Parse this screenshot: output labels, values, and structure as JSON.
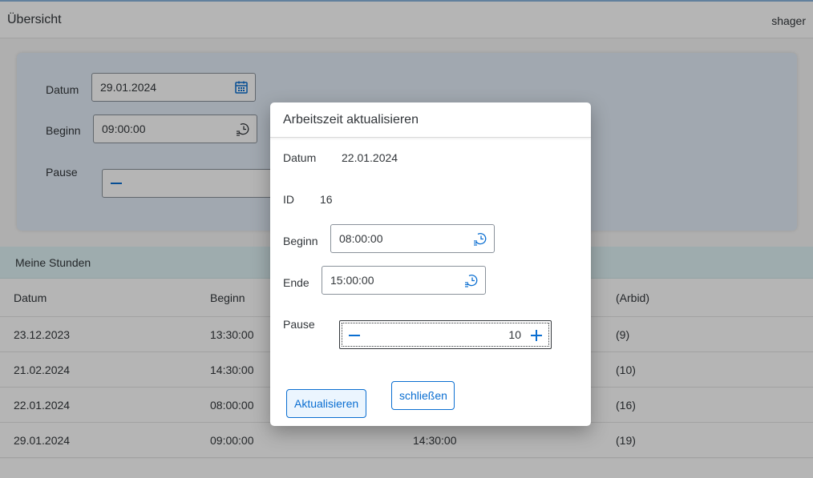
{
  "shell": {
    "title": "Übersicht",
    "user": "shager"
  },
  "form": {
    "date_label": "Datum",
    "date_value": "29.01.2024",
    "start_label": "Beginn",
    "start_value": "09:00:00",
    "pause_label": "Pause"
  },
  "section": {
    "title": "Meine Stunden"
  },
  "table": {
    "headers": [
      "Datum",
      "Beginn",
      "",
      "(Arbid)"
    ],
    "rows": [
      [
        "23.12.2023",
        "13:30:00",
        "",
        "(9)"
      ],
      [
        "21.02.2024",
        "14:30:00",
        "",
        "(10)"
      ],
      [
        "22.01.2024",
        "08:00:00",
        "",
        "(16)"
      ],
      [
        "29.01.2024",
        "09:00:00",
        "14:30:00",
        "(19)"
      ]
    ]
  },
  "dialog": {
    "title": "Arbeitszeit aktualisieren",
    "date_label": "Datum",
    "date_value": "22.01.2024",
    "id_label": "ID",
    "id_value": "16",
    "start_label": "Beginn",
    "start_value": "08:00:00",
    "end_label": "Ende",
    "end_value": "15:00:00",
    "pause_label": "Pause",
    "pause_value": "10",
    "update_button": "Aktualisieren",
    "close_button": "schließen"
  },
  "icons": {
    "calendar": "calendar-icon",
    "time": "time-entry-icon",
    "minus": "minus-icon",
    "plus": "plus-icon"
  },
  "colors": {
    "accent": "#0a6ed1",
    "form_panel": "#e3edf8",
    "section_header": "#dff3f5"
  }
}
